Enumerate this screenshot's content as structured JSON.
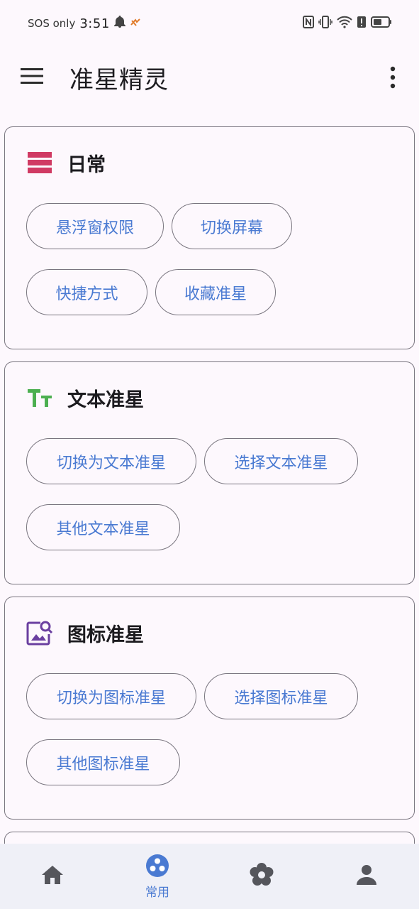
{
  "status_bar": {
    "carrier": "SOS only",
    "time": "3:51"
  },
  "app_bar": {
    "title": "准星精灵"
  },
  "sections": [
    {
      "title": "日常",
      "icon": "list-icon",
      "icon_color": "#d03a63",
      "buttons": [
        "悬浮窗权限",
        "切换屏幕",
        "快捷方式",
        "收藏准星"
      ]
    },
    {
      "title": "文本准星",
      "icon": "text-format-icon",
      "icon_color": "#4caf50",
      "buttons": [
        "切换为文本准星",
        "选择文本准星",
        "其他文本准星"
      ]
    },
    {
      "title": "图标准星",
      "icon": "image-search-icon",
      "icon_color": "#6a3fa0",
      "buttons": [
        "切换为图标准星",
        "选择图标准星",
        "其他图标准星"
      ]
    }
  ],
  "bottom_nav": {
    "items": [
      {
        "name": "home",
        "icon": "home-icon",
        "label": ""
      },
      {
        "name": "common",
        "icon": "scatter-icon",
        "label": "常用",
        "selected": true
      },
      {
        "name": "settings",
        "icon": "flower-icon",
        "label": ""
      },
      {
        "name": "profile",
        "icon": "person-icon",
        "label": ""
      }
    ]
  },
  "colors": {
    "accent": "#4a7ad2",
    "background": "#fdf8fd",
    "outline": "#79757f",
    "nav_background": "#eff0f7"
  }
}
